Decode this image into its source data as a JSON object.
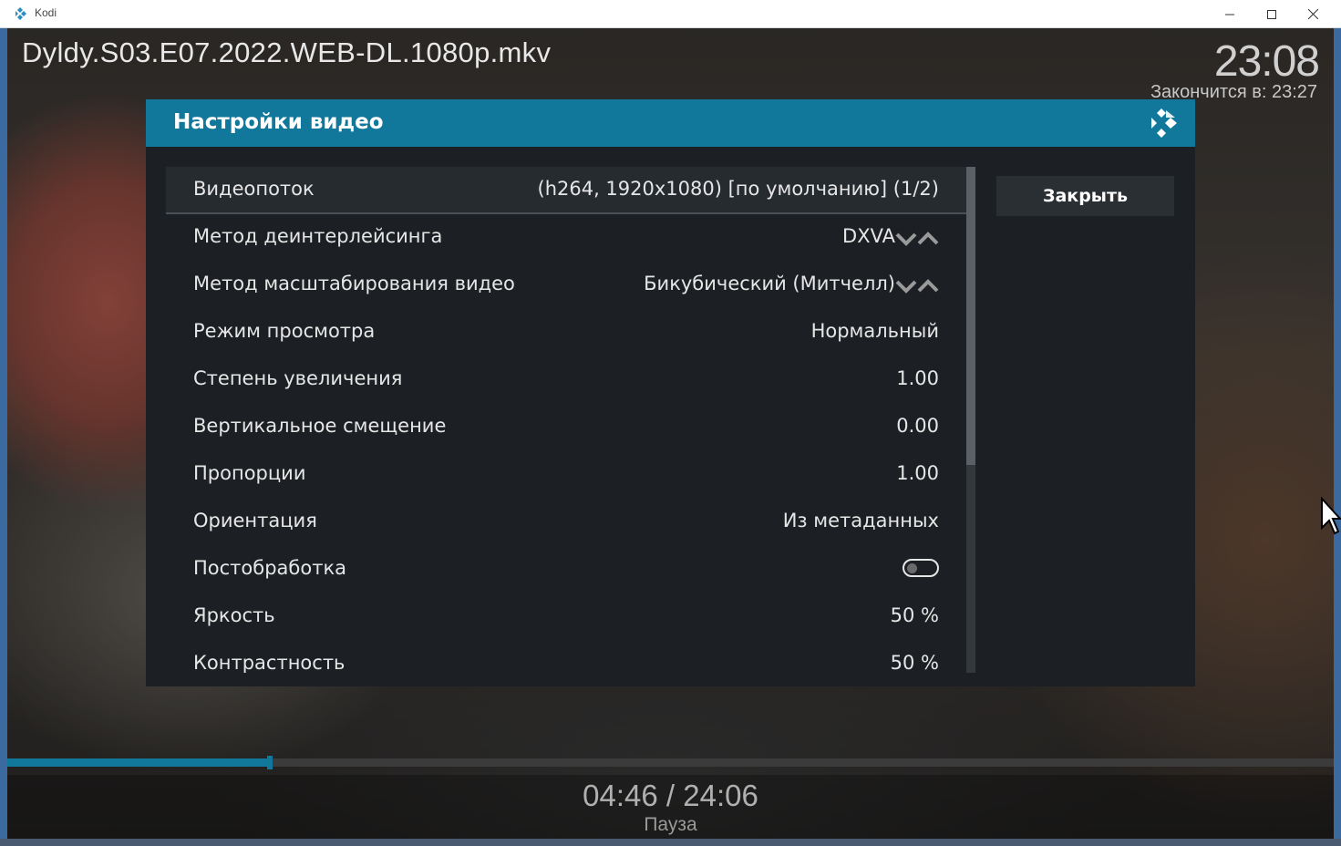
{
  "window": {
    "title": "Kodi",
    "icon": "kodi-logo-icon"
  },
  "player": {
    "file_title": "Dyldy.S03.E07.2022.WEB-DL.1080p.mkv",
    "clock": "23:08",
    "ends_at": "Закончится в: 23:27",
    "time_readout": "04:46 / 24:06",
    "state": "Пауза",
    "progress_fraction": 0.198
  },
  "dialog": {
    "title": "Настройки видео",
    "close_label": "Закрыть",
    "scroll_fraction_visible": 0.59,
    "settings": [
      {
        "label": "Видеопоток",
        "value": "(h264, 1920x1080) [по умолчанию] (1/2)",
        "control": "value",
        "selected": true
      },
      {
        "label": "Метод деинтерлейсинга",
        "value": "DXVA",
        "control": "spinner"
      },
      {
        "label": "Метод масштабирования видео",
        "value": "Бикубический (Митчелл)",
        "control": "spinner"
      },
      {
        "label": "Режим просмотра",
        "value": "Нормальный",
        "control": "value"
      },
      {
        "label": "Степень увеличения",
        "value": "1.00",
        "control": "value"
      },
      {
        "label": "Вертикальное смещение",
        "value": "0.00",
        "control": "value"
      },
      {
        "label": "Пропорции",
        "value": "1.00",
        "control": "value"
      },
      {
        "label": "Ориентация",
        "value": "Из метаданных",
        "control": "value"
      },
      {
        "label": "Постобработка",
        "value": "",
        "control": "toggle",
        "toggle_on": false
      },
      {
        "label": "Яркость",
        "value": "50 %",
        "control": "value"
      },
      {
        "label": "Контрастность",
        "value": "50 %",
        "control": "value"
      }
    ]
  },
  "colors": {
    "accent": "#12789b",
    "dialog_bg": "#1c2024",
    "text": "#e6e6e6"
  }
}
